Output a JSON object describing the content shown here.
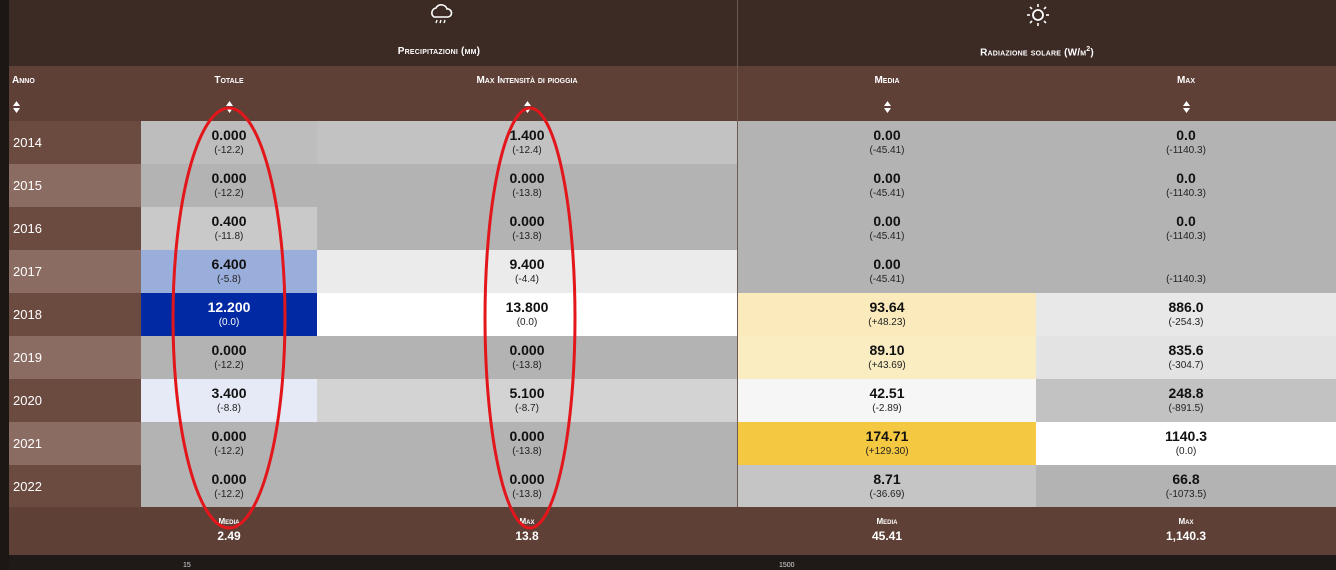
{
  "groups": {
    "precip": {
      "title": "Precipitazioni (mm)",
      "icon": "rain-cloud-icon"
    },
    "solar": {
      "title_main": "Radiazione solare (W/m",
      "title_sup": "2",
      "title_end": ")",
      "icon": "sun-icon"
    }
  },
  "columns": {
    "year": "Anno",
    "totale": "Totale",
    "max_int": "Max Intensità di pioggia",
    "media": "Media",
    "max": "Max"
  },
  "rows": [
    {
      "year": "2014",
      "totale": {
        "v": "0.000",
        "d": "(-12.2)"
      },
      "max_int": {
        "v": "1.400",
        "d": "(-12.4)"
      },
      "media": {
        "v": "0.00",
        "d": "(-45.41)"
      },
      "max": {
        "v": "0.0",
        "d": "(-1140.3)"
      }
    },
    {
      "year": "2015",
      "totale": {
        "v": "0.000",
        "d": "(-12.2)"
      },
      "max_int": {
        "v": "0.000",
        "d": "(-13.8)"
      },
      "media": {
        "v": "0.00",
        "d": "(-45.41)"
      },
      "max": {
        "v": "0.0",
        "d": "(-1140.3)"
      }
    },
    {
      "year": "2016",
      "totale": {
        "v": "0.400",
        "d": "(-11.8)"
      },
      "max_int": {
        "v": "0.000",
        "d": "(-13.8)"
      },
      "media": {
        "v": "0.00",
        "d": "(-45.41)"
      },
      "max": {
        "v": "0.0",
        "d": "(-1140.3)"
      }
    },
    {
      "year": "2017",
      "totale": {
        "v": "6.400",
        "d": "(-5.8)"
      },
      "max_int": {
        "v": "9.400",
        "d": "(-4.4)"
      },
      "media": {
        "v": "0.00",
        "d": "(-45.41)"
      },
      "max": {
        "v": "",
        "d": "(-1140.3)"
      }
    },
    {
      "year": "2018",
      "totale": {
        "v": "12.200",
        "d": "(0.0)"
      },
      "max_int": {
        "v": "13.800",
        "d": "(0.0)"
      },
      "media": {
        "v": "93.64",
        "d": "(+48.23)"
      },
      "max": {
        "v": "886.0",
        "d": "(-254.3)"
      }
    },
    {
      "year": "2019",
      "totale": {
        "v": "0.000",
        "d": "(-12.2)"
      },
      "max_int": {
        "v": "0.000",
        "d": "(-13.8)"
      },
      "media": {
        "v": "89.10",
        "d": "(+43.69)"
      },
      "max": {
        "v": "835.6",
        "d": "(-304.7)"
      }
    },
    {
      "year": "2020",
      "totale": {
        "v": "3.400",
        "d": "(-8.8)"
      },
      "max_int": {
        "v": "5.100",
        "d": "(-8.7)"
      },
      "media": {
        "v": "42.51",
        "d": "(-2.89)"
      },
      "max": {
        "v": "248.8",
        "d": "(-891.5)"
      }
    },
    {
      "year": "2021",
      "totale": {
        "v": "0.000",
        "d": "(-12.2)"
      },
      "max_int": {
        "v": "0.000",
        "d": "(-13.8)"
      },
      "media": {
        "v": "174.71",
        "d": "(+129.30)"
      },
      "max": {
        "v": "1140.3",
        "d": "(0.0)"
      }
    },
    {
      "year": "2022",
      "totale": {
        "v": "0.000",
        "d": "(-12.2)"
      },
      "max_int": {
        "v": "0.000",
        "d": "(-13.8)"
      },
      "media": {
        "v": "8.71",
        "d": "(-36.69)"
      },
      "max": {
        "v": "66.8",
        "d": "(-1073.5)"
      }
    }
  ],
  "colors": {
    "year_bg_odd": "#6b4a40",
    "year_bg_even": "#8b6c62",
    "totale": [
      "#bdbdbd",
      "#b3b3b3",
      "#c9c9c9",
      "#9aaedb",
      "#0029a3",
      "#b3b3b3",
      "#e5eaf6",
      "#b3b3b3",
      "#b3b3b3"
    ],
    "max_int": [
      "#c2c2c2",
      "#b3b3b3",
      "#b3b3b3",
      "#ebebeb",
      "#ffffff",
      "#b3b3b3",
      "#d3d3d3",
      "#b3b3b3",
      "#b3b3b3"
    ],
    "media": [
      "#b3b3b3",
      "#b3b3b3",
      "#b3b3b3",
      "#b3b3b3",
      "#fbebbc",
      "#fbedc2",
      "#f6f6f6",
      "#f5c842",
      "#c5c5c5"
    ],
    "max": [
      "#b3b3b3",
      "#b3b3b3",
      "#b3b3b3",
      "#b3b3b3",
      "#e8e8e8",
      "#e3e3e3",
      "#c2c2c2",
      "#ffffff",
      "#b3b3b3"
    ],
    "annotation": "#e3161b"
  },
  "footer": {
    "totale": {
      "label": "Media",
      "value": "2.49"
    },
    "max_int": {
      "label": "Max",
      "value": "13.8"
    },
    "media": {
      "label": "Media",
      "value": "45.41"
    },
    "max": {
      "label": "Max",
      "value": "1,140.3"
    }
  },
  "chart_axis": {
    "left": "15",
    "right": "1500"
  }
}
